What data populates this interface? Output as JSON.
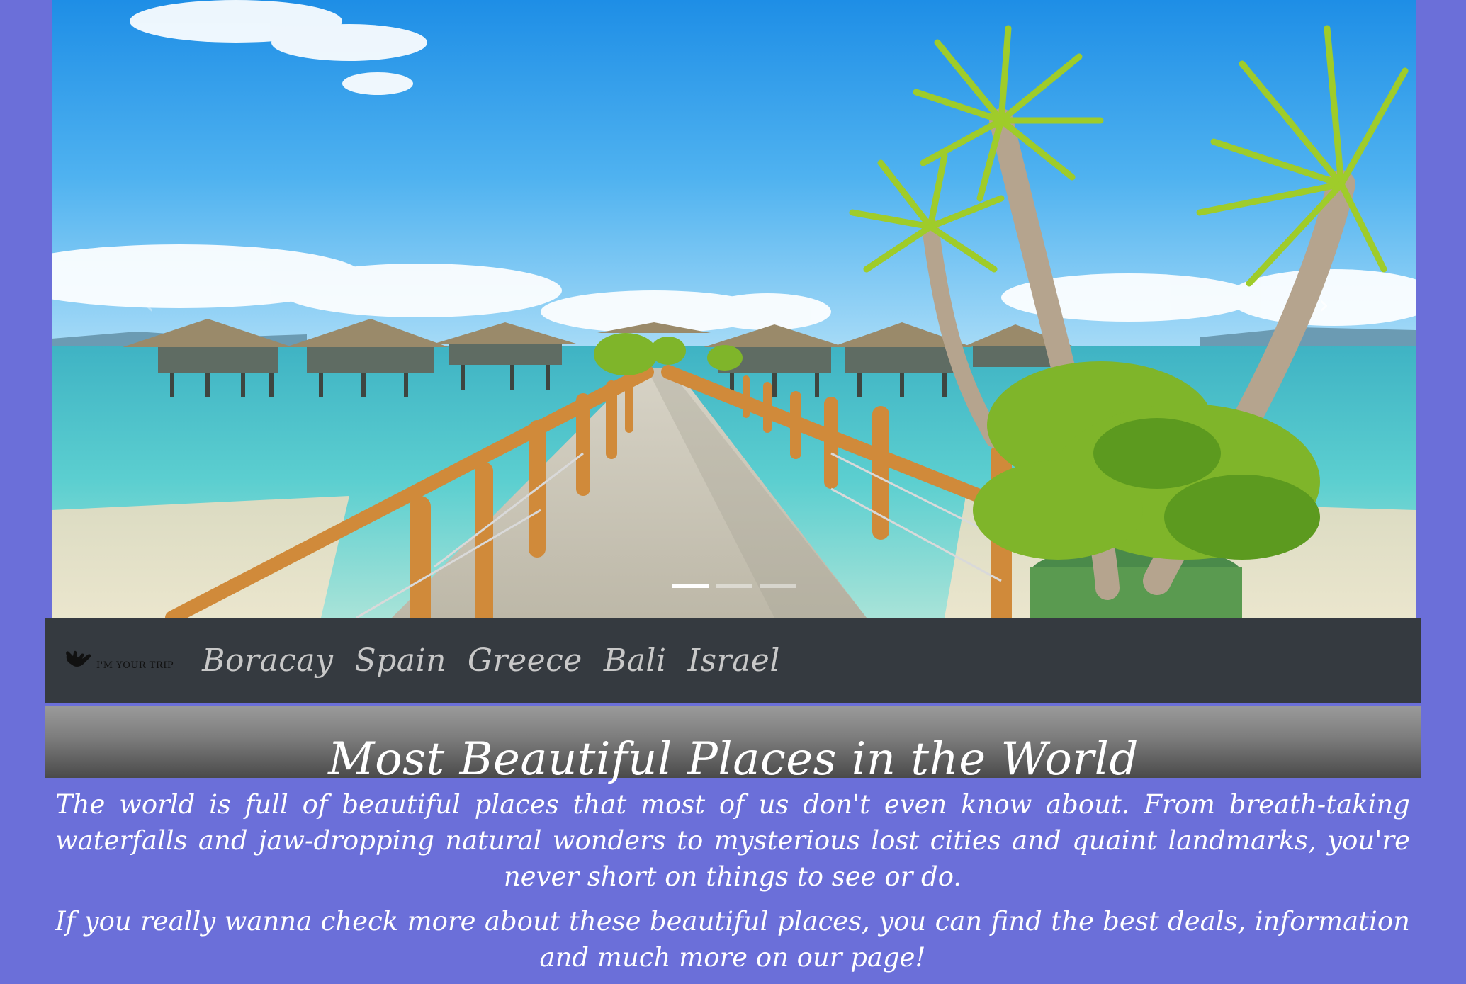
{
  "hero": {
    "image_icon": "tropical-pier-photo",
    "indicators": 3,
    "active_indicator": 1,
    "next_glyph": "›",
    "prev_glyph": "‹"
  },
  "navbar": {
    "brand": {
      "icon": "shaka-hand-icon",
      "text": "I'M YOUR TRIP"
    },
    "links": [
      "Boracay",
      "Spain",
      "Greece",
      "Bali",
      "Israel"
    ]
  },
  "main": {
    "title": "Most Beautiful Places in the World",
    "paragraphs": [
      "The world is full of beautiful places that most of us don't even know about. From breath-taking waterfalls and jaw-dropping natural wonders to mysterious lost cities and quaint landmarks, you're never short on things to see or do.",
      "If you really wanna check more about these beautiful places, you can find the best deals, information and much more on our page!"
    ]
  },
  "colors": {
    "page_background": "#6b6fd9",
    "navbar_background": "#353a40",
    "nav_link": "#c8c8c8",
    "title_band_top": "#9b9b9b",
    "title_band_bottom": "#4a4a4a",
    "text": "#ffffff"
  }
}
